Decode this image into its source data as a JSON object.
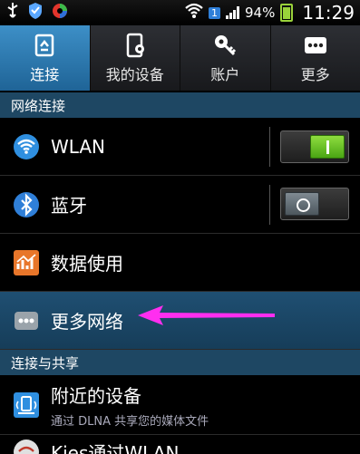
{
  "status_bar": {
    "time": "11:29",
    "battery": "94%",
    "notification_count": "1"
  },
  "tabs": [
    {
      "label": "连接",
      "icon": "connection-icon",
      "active": true
    },
    {
      "label": "我的设备",
      "icon": "device-icon",
      "active": false
    },
    {
      "label": "账户",
      "icon": "key-icon",
      "active": false
    },
    {
      "label": "更多",
      "icon": "more-icon",
      "active": false
    }
  ],
  "sections": {
    "network": {
      "title": "网络连接"
    },
    "share": {
      "title": "连接与共享"
    }
  },
  "items": {
    "wlan": {
      "label": "WLAN",
      "toggle": "on"
    },
    "bluetooth": {
      "label": "蓝牙",
      "toggle": "off"
    },
    "data_usage": {
      "label": "数据使用"
    },
    "more_networks": {
      "label": "更多网络"
    },
    "nearby": {
      "label": "附近的设备",
      "sub": "通过 DLNA 共享您的媒体文件"
    },
    "kies": {
      "label": "Kies通过WLAN"
    }
  },
  "colors": {
    "accent": "#3d8fc7",
    "section_bg": "#1e4763",
    "toggle_on": "#6cc52a",
    "arrow": "#ff2ef0"
  }
}
